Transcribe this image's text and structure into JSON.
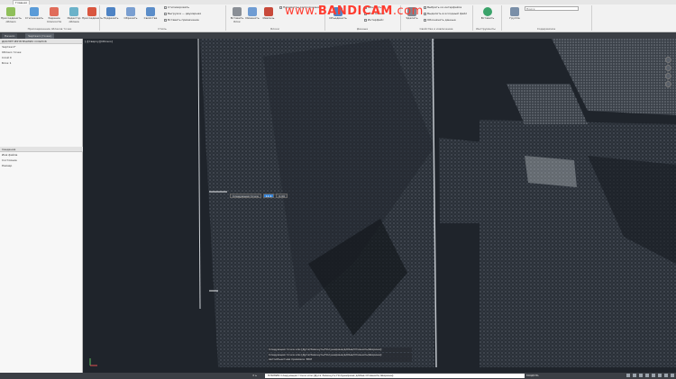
{
  "watermark": {
    "brand": "www.",
    "name": "BANDICAM",
    "tld": ".com"
  },
  "ribbon": {
    "tabs": [
      "Главная"
    ],
    "buttons": [
      {
        "label": "Присоединить облако"
      },
      {
        "label": "Стилизовать"
      },
      {
        "label": "Задание плоскости"
      },
      {
        "label": "Редактор облака"
      },
      {
        "label": "Присоединить"
      },
      {
        "label": "Подрезать"
      },
      {
        "label": "Обрезать"
      },
      {
        "label": "Свойства"
      },
      {
        "label": "Вставить блок"
      },
      {
        "label": "Изменить"
      },
      {
        "label": "Извлечь"
      },
      {
        "label": "Объединить"
      },
      {
        "label": "Удалить"
      },
      {
        "label": "Смещение"
      },
      {
        "label": "Связать"
      },
      {
        "label": "Вставить"
      },
      {
        "label": "Группа"
      }
    ],
    "small_rows": [
      "Стилизировать",
      "Выгрузка — двумерная",
      "Вставить примечание",
      "Параметры расположения",
      "Обновить",
      "ОСО объект",
      "Интерфейс",
      "Выбрать из интерфейса",
      "Выделить в исходный файл",
      "Обозначить данные"
    ],
    "panel_labels": [
      "Присоединение облаков точек",
      "Стиль",
      "Обрезка",
      "Подрезка",
      "Блоки",
      "Данные",
      "Свойства и извлечение",
      "Инструменты",
      "Содержимое"
    ],
    "search_placeholder": "Поиск"
  },
  "doc_tabs": [
    "Начало",
    "Чертеж1 (точки)"
  ],
  "left_panel": {
    "header": "ДИСПЕТЧЕР ВНЕШНИХ ССЫЛОК",
    "items": [
      "Чертеж1*",
      "Облако точек",
      "Слой 0",
      "Блок 1"
    ],
    "section2_header": "Сведения",
    "section2_items": [
      "Имя файла",
      "Состояние",
      "Размер"
    ]
  },
  "viewport": {
    "label": "[-][Сверху][Облако]",
    "prompt_fields": [
      "Следующая точка",
      "12.4",
      "0.00"
    ]
  },
  "command_history": [
    "Следующая точка или [Дуга/Замкнуть/Полуширина/длИна/Отменить/Ширина]:",
    "Следующая точка или [Дуга/Замкнуть/Полуширина/длИна/Отменить/Ширина]:",
    "Автообъектная привязка: ВКЛ"
  ],
  "command_input": "ПЛИНИЯ Следующая точка или [Дуга Замкнуть Полуширина длИна Отменить Ширина]:",
  "status": {
    "model_tab": "МОДЕЛЬ"
  }
}
